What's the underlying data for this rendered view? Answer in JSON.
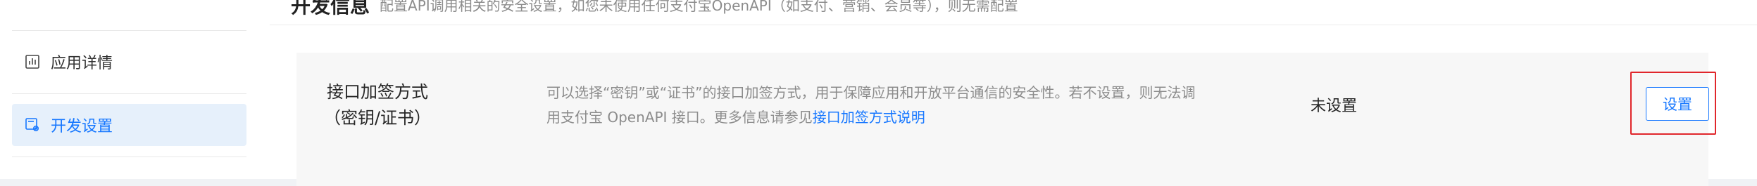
{
  "sidebar": {
    "items": [
      {
        "label": "应用详情",
        "icon": "chart-icon",
        "active": false
      },
      {
        "label": "开发设置",
        "icon": "settings-gear-icon",
        "active": true
      }
    ]
  },
  "header": {
    "title": "开发信息",
    "description": "配置API调用相关的安全设置，如您未使用任何支付宝OpenAPI（如支付、营销、会员等），则无需配置"
  },
  "settings": [
    {
      "name_line1": "接口加签方式",
      "name_line2": "（密钥/证书）",
      "description_line1": "可以选择“密钥”或“证书”的接口加签方式，用于保障应用和开放平台通信的安全性。若不设置，则无法调",
      "description_line2": "用支付宝 OpenAPI 接口。更多信息请参见",
      "description_link": "接口加签方式说明",
      "status": "未设置",
      "action_label": "设置"
    }
  ],
  "colors": {
    "accent": "#1677ff",
    "highlight": "#e0262b",
    "active_bg": "#e6f0fb"
  }
}
